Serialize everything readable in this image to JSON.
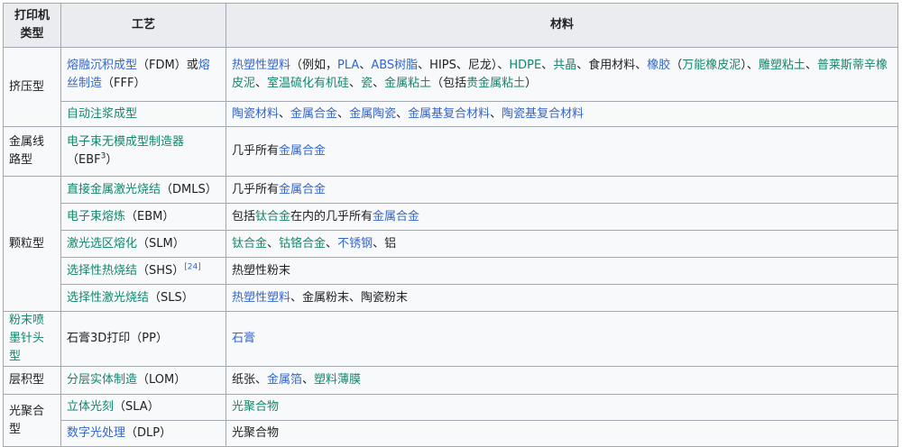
{
  "header": {
    "col1": "打印机类型",
    "col2": "工艺",
    "col3": "材料"
  },
  "colors": {
    "link": "#3366cc",
    "visited_link": "#14866d",
    "text": "#202122",
    "header_bg": "#eaecf0",
    "border": "#a2a9b1"
  },
  "rows": [
    {
      "height": 60,
      "category": [
        {
          "t": "挤压型"
        }
      ],
      "category_rowspan": 2,
      "process": [
        {
          "t": "熔融沉积成型",
          "c": "blue"
        },
        {
          "t": "（FDM）或"
        },
        {
          "t": "熔丝制造",
          "c": "blue"
        },
        {
          "t": "（FFF）"
        }
      ],
      "material": [
        {
          "t": "热塑性塑料",
          "c": "blue"
        },
        {
          "t": "（例如，"
        },
        {
          "t": "PLA",
          "c": "blue"
        },
        {
          "t": "、"
        },
        {
          "t": "ABS树脂",
          "c": "blue"
        },
        {
          "t": "、HIPS、尼龙）、"
        },
        {
          "t": "HDPE",
          "c": "green"
        },
        {
          "t": "、"
        },
        {
          "t": "共晶",
          "c": "green"
        },
        {
          "t": "、食用材料、"
        },
        {
          "t": "橡胶",
          "c": "blue"
        },
        {
          "t": "（"
        },
        {
          "t": "万能橡皮泥",
          "c": "green"
        },
        {
          "t": "）、"
        },
        {
          "t": "雕塑粘土",
          "c": "green"
        },
        {
          "t": "、"
        },
        {
          "t": "普莱斯蒂辛橡皮泥",
          "c": "green"
        },
        {
          "t": "、"
        },
        {
          "t": "室温硫化有机硅",
          "c": "green"
        },
        {
          "t": "、"
        },
        {
          "t": "瓷",
          "c": "green"
        },
        {
          "t": "、"
        },
        {
          "t": "金属粘土",
          "c": "green"
        },
        {
          "t": "（包括"
        },
        {
          "t": "贵金属粘土",
          "c": "green"
        },
        {
          "t": "）"
        }
      ]
    },
    {
      "height": 28,
      "process": [
        {
          "t": "自动注浆成型",
          "c": "green"
        }
      ],
      "material": [
        {
          "t": "陶瓷材料",
          "c": "blue"
        },
        {
          "t": "、"
        },
        {
          "t": "金属合金",
          "c": "blue"
        },
        {
          "t": "、"
        },
        {
          "t": "金属陶瓷",
          "c": "blue"
        },
        {
          "t": "、"
        },
        {
          "t": "金属基复合材料",
          "c": "blue"
        },
        {
          "t": "、"
        },
        {
          "t": "陶瓷基复合材料",
          "c": "blue"
        }
      ]
    },
    {
      "height": 55,
      "category": [
        {
          "t": "金属线路型"
        }
      ],
      "category_rowspan": 1,
      "process": [
        {
          "t": "电子束无模成型制造器",
          "c": "green"
        },
        {
          "t": "（EBF"
        },
        {
          "t": "3",
          "c": "sup"
        },
        {
          "t": "）"
        }
      ],
      "material": [
        {
          "t": "几乎所有"
        },
        {
          "t": "金属合金",
          "c": "blue"
        }
      ]
    },
    {
      "height": 30,
      "category": [
        {
          "t": "颗粒型"
        }
      ],
      "category_rowspan": 5,
      "process": [
        {
          "t": "直接金属激光烧结",
          "c": "green"
        },
        {
          "t": "（DMLS）"
        }
      ],
      "material": [
        {
          "t": "几乎所有"
        },
        {
          "t": "金属合金",
          "c": "blue"
        }
      ]
    },
    {
      "height": 30,
      "process": [
        {
          "t": "电子束熔炼",
          "c": "green"
        },
        {
          "t": "（EBM）"
        }
      ],
      "material": [
        {
          "t": "包括"
        },
        {
          "t": "钛合金",
          "c": "green"
        },
        {
          "t": "在内的几乎所有"
        },
        {
          "t": "金属合金",
          "c": "blue"
        }
      ]
    },
    {
      "height": 30,
      "process": [
        {
          "t": "激光选区熔化",
          "c": "green"
        },
        {
          "t": "（SLM）"
        }
      ],
      "material": [
        {
          "t": "钛合金",
          "c": "green"
        },
        {
          "t": "、"
        },
        {
          "t": "钴铬合金",
          "c": "green"
        },
        {
          "t": "、"
        },
        {
          "t": "不锈钢",
          "c": "blue"
        },
        {
          "t": "、铝"
        }
      ]
    },
    {
      "height": 30,
      "process": [
        {
          "t": "选择性热烧结",
          "c": "green"
        },
        {
          "t": "（SHS）"
        },
        {
          "t": "[24]",
          "c": "supblue"
        }
      ],
      "material": [
        {
          "t": "热塑性粉末"
        }
      ]
    },
    {
      "height": 30,
      "process": [
        {
          "t": "选择性激光烧结",
          "c": "green"
        },
        {
          "t": "（SLS）"
        }
      ],
      "material": [
        {
          "t": "热塑性塑料",
          "c": "blue"
        },
        {
          "t": "、金属粉末、陶瓷粉末"
        }
      ]
    },
    {
      "height": 54,
      "category": [
        {
          "t": "粉末喷墨针头型",
          "c": "green"
        }
      ],
      "category_rowspan": 1,
      "process": [
        {
          "t": "石膏3D打印（PP）"
        }
      ],
      "material": [
        {
          "t": "石膏",
          "c": "blue"
        }
      ]
    },
    {
      "height": 31,
      "category": [
        {
          "t": "层积型"
        }
      ],
      "category_rowspan": 1,
      "process": [
        {
          "t": "分层实体制造",
          "c": "green"
        },
        {
          "t": "（LOM）"
        }
      ],
      "material": [
        {
          "t": "纸张、"
        },
        {
          "t": "金属箔",
          "c": "blue"
        },
        {
          "t": "、"
        },
        {
          "t": "塑料薄膜",
          "c": "green"
        }
      ]
    },
    {
      "height": 29,
      "category": [
        {
          "t": "光聚合型"
        }
      ],
      "category_rowspan": 2,
      "process": [
        {
          "t": "立体光刻",
          "c": "green"
        },
        {
          "t": "（SLA）"
        }
      ],
      "material": [
        {
          "t": "光聚合物",
          "c": "green"
        }
      ]
    },
    {
      "height": 29,
      "process": [
        {
          "t": "数字光处理",
          "c": "blue"
        },
        {
          "t": "（DLP）"
        }
      ],
      "material": [
        {
          "t": "光聚合物"
        }
      ]
    }
  ]
}
